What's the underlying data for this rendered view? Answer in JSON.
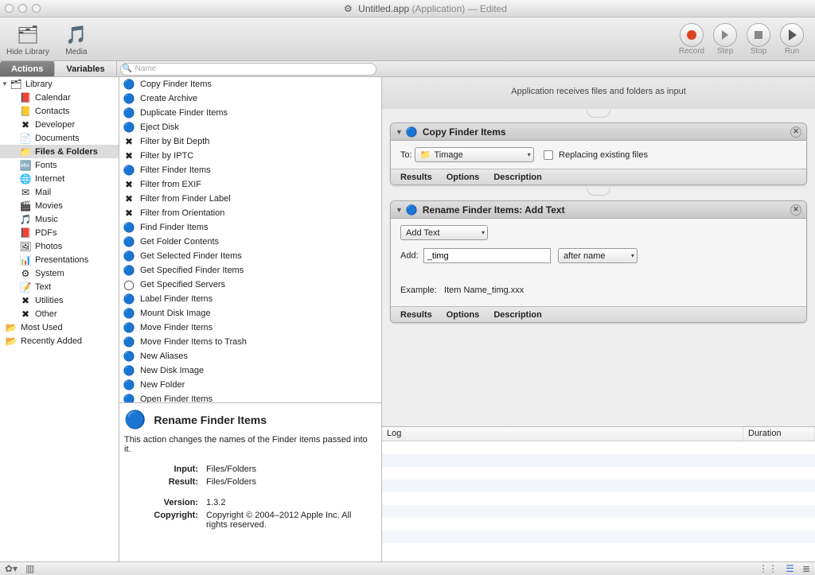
{
  "title": {
    "name": "Untitled.app",
    "type": "(Application)",
    "status": "— Edited"
  },
  "toolbar": {
    "hideLibrary": "Hide Library",
    "media": "Media",
    "record": "Record",
    "step": "Step",
    "stop": "Stop",
    "run": "Run"
  },
  "tabs": {
    "actions": "Actions",
    "variables": "Variables"
  },
  "search": {
    "placeholder": "Name"
  },
  "library": {
    "root": "Library",
    "items": [
      {
        "label": "Calendar",
        "icon": "📕"
      },
      {
        "label": "Contacts",
        "icon": "📒"
      },
      {
        "label": "Developer",
        "icon": "✖"
      },
      {
        "label": "Documents",
        "icon": "📄"
      },
      {
        "label": "Files & Folders",
        "icon": "📁",
        "selected": true
      },
      {
        "label": "Fonts",
        "icon": "🔤"
      },
      {
        "label": "Internet",
        "icon": "🌐"
      },
      {
        "label": "Mail",
        "icon": "✉"
      },
      {
        "label": "Movies",
        "icon": "🎬"
      },
      {
        "label": "Music",
        "icon": "🎵"
      },
      {
        "label": "PDFs",
        "icon": "📕"
      },
      {
        "label": "Photos",
        "icon": "🖼"
      },
      {
        "label": "Presentations",
        "icon": "📊"
      },
      {
        "label": "System",
        "icon": "⚙"
      },
      {
        "label": "Text",
        "icon": "📝"
      },
      {
        "label": "Utilities",
        "icon": "✖"
      },
      {
        "label": "Other",
        "icon": "✖"
      }
    ],
    "footer": [
      {
        "label": "Most Used",
        "icon": "📂"
      },
      {
        "label": "Recently Added",
        "icon": "📂"
      }
    ]
  },
  "actions": [
    {
      "label": "Copy Finder Items",
      "icon": "🔵"
    },
    {
      "label": "Create Archive",
      "icon": "🔵"
    },
    {
      "label": "Duplicate Finder Items",
      "icon": "🔵"
    },
    {
      "label": "Eject Disk",
      "icon": "🔵"
    },
    {
      "label": "Filter by Bit Depth",
      "icon": "✖"
    },
    {
      "label": "Filter by IPTC",
      "icon": "✖"
    },
    {
      "label": "Filter Finder Items",
      "icon": "🔵"
    },
    {
      "label": "Filter from EXIF",
      "icon": "✖"
    },
    {
      "label": "Filter from Finder Label",
      "icon": "✖"
    },
    {
      "label": "Filter from Orientation",
      "icon": "✖"
    },
    {
      "label": "Find Finder Items",
      "icon": "🔵"
    },
    {
      "label": "Get Folder Contents",
      "icon": "🔵"
    },
    {
      "label": "Get Selected Finder Items",
      "icon": "🔵"
    },
    {
      "label": "Get Specified Finder Items",
      "icon": "🔵"
    },
    {
      "label": "Get Specified Servers",
      "icon": "◯"
    },
    {
      "label": "Label Finder Items",
      "icon": "🔵"
    },
    {
      "label": "Mount Disk Image",
      "icon": "🔵"
    },
    {
      "label": "Move Finder Items",
      "icon": "🔵"
    },
    {
      "label": "Move Finder Items to Trash",
      "icon": "🔵"
    },
    {
      "label": "New Aliases",
      "icon": "🔵"
    },
    {
      "label": "New Disk Image",
      "icon": "🔵"
    },
    {
      "label": "New Folder",
      "icon": "🔵"
    },
    {
      "label": "Open Finder Items",
      "icon": "🔵"
    },
    {
      "label": "Rename Finder Items",
      "icon": "🔵",
      "selected": true
    }
  ],
  "info": {
    "title": "Rename Finder Items",
    "desc": "This action changes the names of the Finder items passed into it.",
    "inputLabel": "Input:",
    "inputVal": "Files/Folders",
    "resultLabel": "Result:",
    "resultVal": "Files/Folders",
    "versionLabel": "Version:",
    "versionVal": "1.3.2",
    "copyrightLabel": "Copyright:",
    "copyrightVal": "Copyright © 2004–2012 Apple Inc.  All rights reserved."
  },
  "flow": {
    "header": "Application receives files and folders as input",
    "block1": {
      "title": "Copy Finder Items",
      "toLabel": "To:",
      "toValue": "Timage",
      "checkbox": "Replacing existing files",
      "results": "Results",
      "options": "Options",
      "description": "Description"
    },
    "block2": {
      "title": "Rename Finder Items: Add Text",
      "mode": "Add Text",
      "addLabel": "Add:",
      "addValue": "_timg",
      "position": "after name",
      "exampleLabel": "Example:",
      "exampleVal": "Item Name_timg.xxx",
      "results": "Results",
      "options": "Options",
      "description": "Description"
    }
  },
  "log": {
    "col1": "Log",
    "col2": "Duration"
  }
}
